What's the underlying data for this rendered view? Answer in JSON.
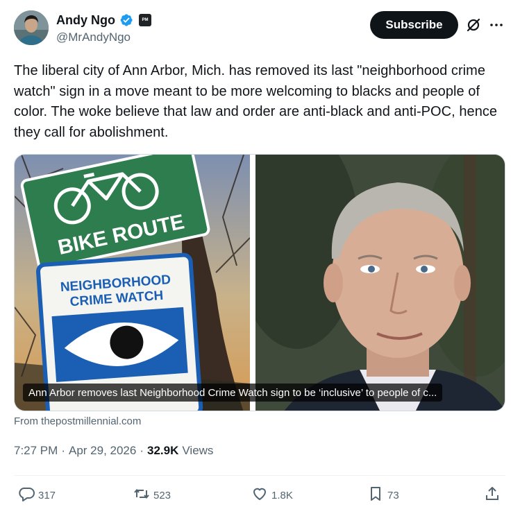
{
  "author": {
    "display_name": "Andy Ngo",
    "handle": "@MrAndyNgo",
    "affiliate_badge": "PM",
    "verified_color": "#1d9bf0"
  },
  "header": {
    "subscribe_label": "Subscribe",
    "grok_icon": "grok-icon",
    "more_icon": "more-icon"
  },
  "tweet": {
    "text": "The liberal city of Ann Arbor, Mich. has removed its last \"neighborhood crime watch\" sign in a move meant to be more welcoming to blacks and people of color. The woke believe that law and order are anti-black and anti-POC, hence they call for abolishment."
  },
  "media": {
    "left_sign_top": "BIKE ROUTE",
    "left_sign_bottom_line1": "NEIGHBORHOOD",
    "left_sign_bottom_line2": "CRIME WATCH",
    "caption": "Ann Arbor removes last Neighborhood Crime Watch sign to be ‘inclusive’ to people of c...",
    "source": "From thepostmillennial.com"
  },
  "meta": {
    "time": "7:27 PM",
    "separator": "·",
    "date": "Apr 29, 2026",
    "views_count": "32.9K",
    "views_label": "Views"
  },
  "actions": {
    "replies": "317",
    "reposts": "523",
    "likes": "1.8K",
    "bookmarks": "73"
  },
  "colors": {
    "text": "#0f1419",
    "secondary": "#536471",
    "brand": "#1d9bf0",
    "sign_green": "#2e7d4f",
    "sign_blue": "#1a5fb4"
  }
}
